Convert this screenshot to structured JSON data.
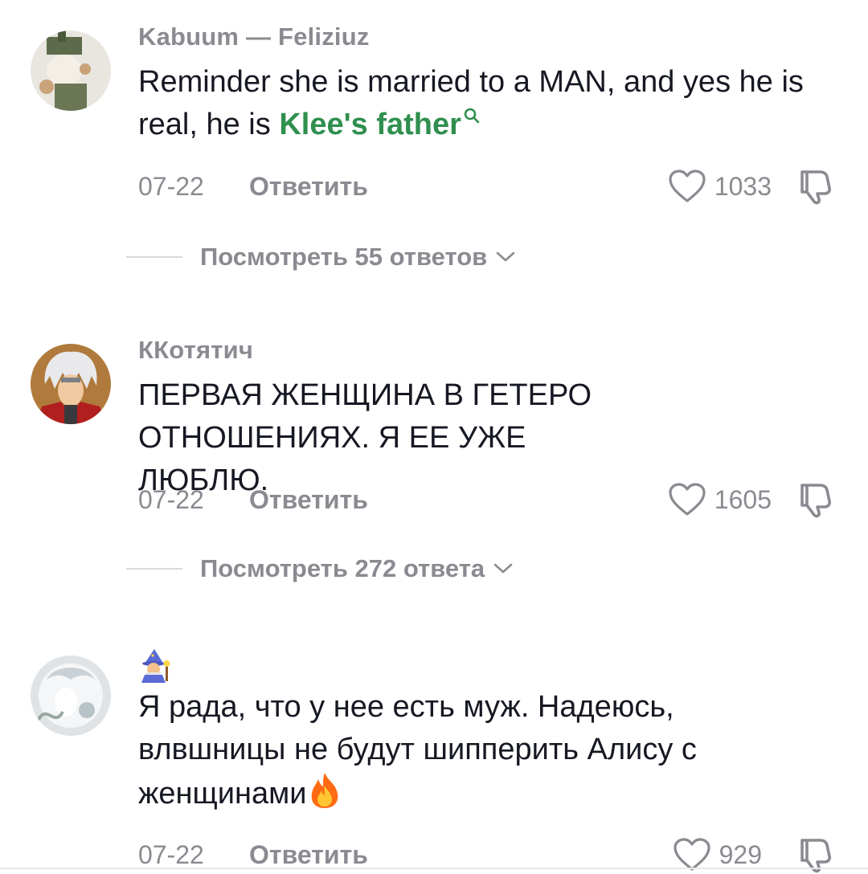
{
  "comments": [
    {
      "username": "Kabuum — Feliziuz",
      "text_prefix": "Reminder she is married to a MAN, and yes he is real, he is ",
      "mention": "Klee's father",
      "date": "07-22",
      "reply_label": "Ответить",
      "likes": "1033",
      "view_replies": "Посмотреть 55 ответов"
    },
    {
      "username": "ККотятич",
      "text": "ПЕРВАЯ ЖЕНЩИНА В ГЕТЕРО ОТНОШЕНИЯХ. Я ЕЕ УЖЕ ЛЮБЛЮ.",
      "date": "07-22",
      "reply_label": "Ответить",
      "likes": "1605",
      "view_replies": "Посмотреть 272 ответа"
    },
    {
      "username_icon": "wizard-emoji",
      "text": "Я рада, что у нее есть муж. Надеюсь, влвшницы не будут шипперить Алису с женщинами",
      "date": "07-22",
      "reply_label": "Ответить",
      "likes": "929"
    }
  ],
  "colors": {
    "muted": "#8a8b91",
    "text": "#161823",
    "mention": "#2f8f4e",
    "accent_fire": "#ff7a1a"
  },
  "icons": [
    "heart-outline-icon",
    "thumbs-down-icon",
    "chevron-down-icon",
    "search-icon",
    "fire-emoji-icon"
  ]
}
